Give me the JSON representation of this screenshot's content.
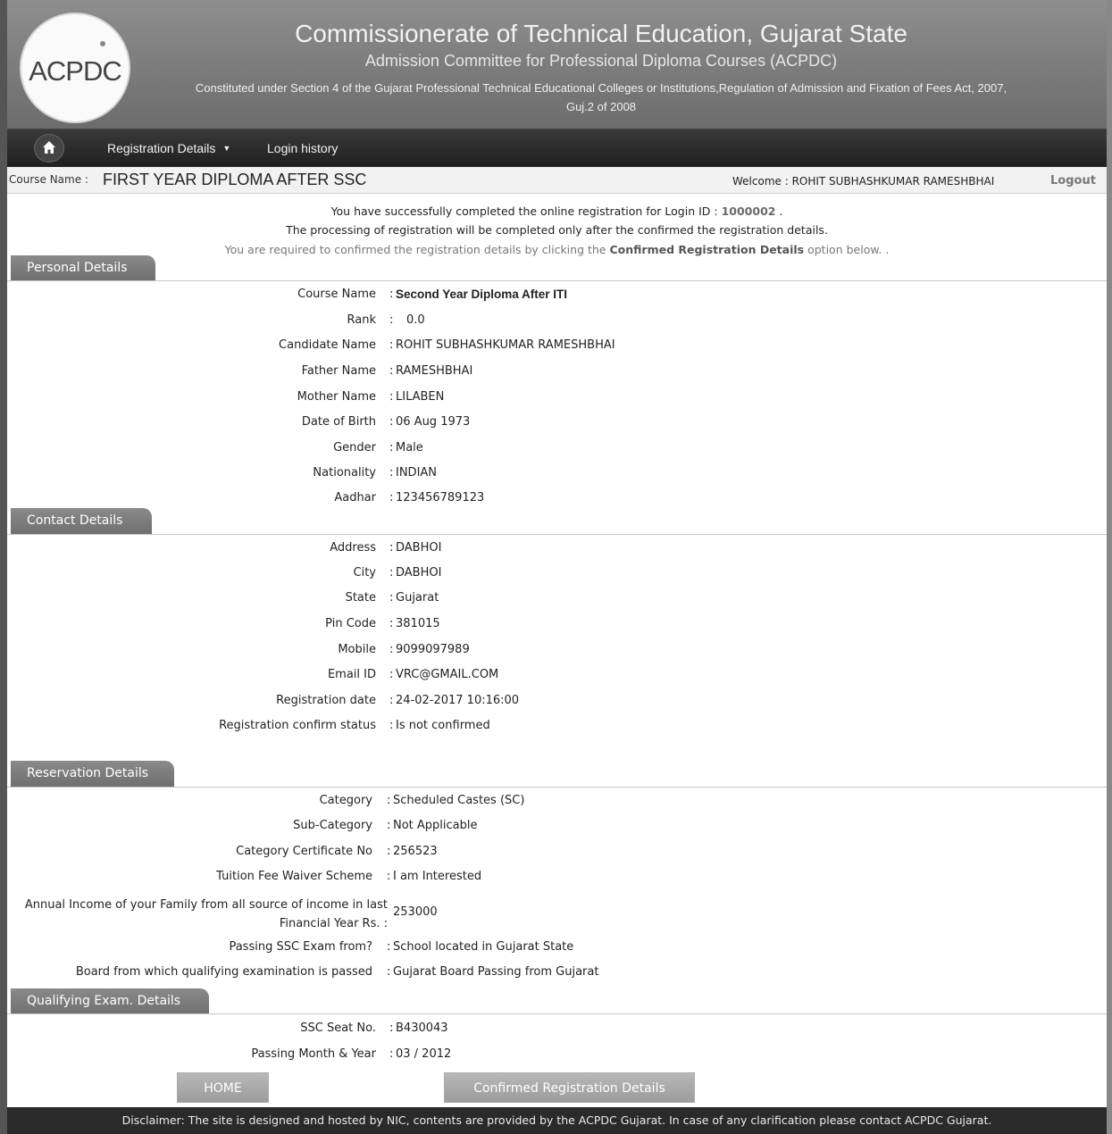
{
  "header": {
    "logo_text": "ACPDC",
    "title": "Commissionerate of Technical Education, Gujarat State",
    "subtitle": "Admission Committee for Professional Diploma Courses (ACPDC)",
    "constitution_line1": "Constituted under Section 4 of the Gujarat Professional Technical Educational Colleges or Institutions,Regulation of Admission and Fixation of Fees Act, 2007,",
    "constitution_line2": "Guj.2 of 2008"
  },
  "nav": {
    "home_icon": "home-icon",
    "items": [
      {
        "label": "Registration Details"
      },
      {
        "label": "Login history"
      }
    ]
  },
  "course_bar": {
    "label": "Course Name :",
    "value": "FIRST YEAR DIPLOMA AFTER SSC",
    "welcome": "Welcome : ROHIT SUBHASHKUMAR RAMESHBHAI",
    "logout": "Logout"
  },
  "notice": {
    "line1_prefix": "You have successfully completed the online registration for Login ID :",
    "login_id": "1000002",
    "line1_suffix": ".",
    "line2": "The processing of registration will be completed only after the confirmed the registration details.",
    "line3_prefix": "You are required to confirmed the registration details by clicking the",
    "line3_bold": "Confirmed Registration Details",
    "line3_suffix": "option below. ."
  },
  "personal": {
    "title": "Personal Details",
    "rows": [
      {
        "label": "Course Name",
        "value": "Second Year Diploma After ITI"
      },
      {
        "label": "Rank",
        "value": "0.0"
      },
      {
        "label": "Candidate Name",
        "value": "ROHIT SUBHASHKUMAR RAMESHBHAI"
      },
      {
        "label": "Father Name",
        "value": "RAMESHBHAI"
      },
      {
        "label": "Mother Name",
        "value": "LILABEN"
      },
      {
        "label": "Date of Birth",
        "value": "06 Aug 1973"
      },
      {
        "label": "Gender",
        "value": "Male"
      },
      {
        "label": "Nationality",
        "value": "INDIAN"
      },
      {
        "label": "Aadhar",
        "value": "123456789123"
      }
    ]
  },
  "contact": {
    "title": "Contact Details",
    "rows": [
      {
        "label": "Address",
        "value": "DABHOI"
      },
      {
        "label": "City",
        "value": "DABHOI"
      },
      {
        "label": "State",
        "value": "Gujarat"
      },
      {
        "label": "Pin Code",
        "value": "381015"
      },
      {
        "label": "Mobile",
        "value": "9099097989"
      },
      {
        "label": "Email ID",
        "value": "VRC@GMAIL.COM"
      },
      {
        "label": "Registration date",
        "value": "24-02-2017 10:16:00"
      },
      {
        "label": "Registration confirm status",
        "value": "Is not confirmed"
      }
    ]
  },
  "reservation": {
    "title": "Reservation Details",
    "rows": [
      {
        "label": "Category",
        "value": "Scheduled Castes (SC)"
      },
      {
        "label": "Sub-Category",
        "value": "Not Applicable"
      },
      {
        "label": "Category Certificate No",
        "value": "256523"
      },
      {
        "label": "Tuition Fee Waiver Scheme",
        "value": "I am Interested"
      }
    ],
    "income_label_line1": "Annual Income of your Family from all source of income in last",
    "income_label_line2": "Financial Year Rs. :",
    "income_value": "253000",
    "rows2": [
      {
        "label": "Passing SSC Exam from?",
        "value": "School located in Gujarat State"
      },
      {
        "label": "Board from which qualifying examination is passed",
        "value": "Gujarat Board Passing from Gujarat"
      }
    ]
  },
  "qualifying": {
    "title": "Qualifying Exam. Details",
    "rows": [
      {
        "label": "SSC Seat No.",
        "value": "B430043"
      },
      {
        "label": "Passing Month & Year",
        "value": "03 / 2012"
      }
    ]
  },
  "buttons": {
    "home": "HOME",
    "confirm": "Confirmed Registration Details"
  },
  "footer": {
    "disclaimer": "Disclaimer: The site is designed and hosted by NIC, contents are provided by the ACPDC Gujarat. In case of any clarification please contact ACPDC Gujarat."
  }
}
